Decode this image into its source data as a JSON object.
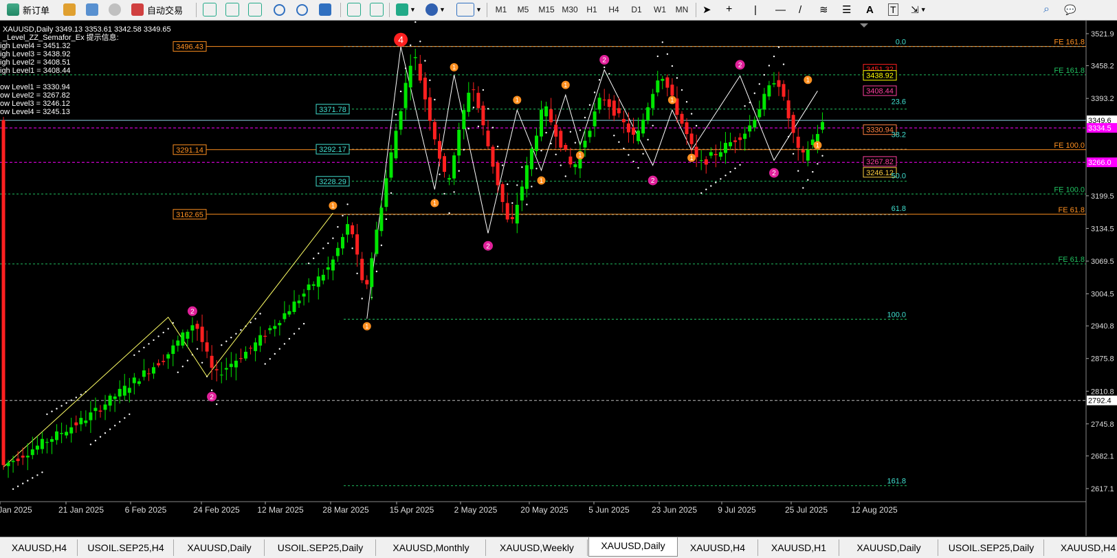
{
  "toolbar": {
    "new_order_label": "新订单",
    "auto_trade_label": "自动交易",
    "timeframes": [
      "M1",
      "M5",
      "M15",
      "M30",
      "H1",
      "H4",
      "D1",
      "W1",
      "MN"
    ]
  },
  "chart_info": {
    "symbol_line": "XAUUSD,Daily  3349.13 3353.61 3342.58 3349.65",
    "indicator_line": "_Level_ZZ_Semafor_Ex 提示信息:",
    "levels": [
      "igh Level4 = 3451.32",
      "igh Level3 = 3438.92",
      "igh Level2 = 3408.51",
      "igh Level1 = 3408.44",
      "ow Level1 = 3330.94",
      "ow Level2 = 3267.82",
      "ow Level3 = 3246.12",
      "ow Level4 = 3245.13"
    ]
  },
  "chart_data": {
    "type": "candlestick",
    "symbol": "XAUUSD",
    "timeframe": "Daily",
    "ohlc_last": {
      "open": 3349.13,
      "high": 3353.61,
      "low": 3342.58,
      "close": 3349.65
    },
    "y_ticks": [
      3521.9,
      3458.2,
      3393.2,
      3334.5,
      3266.0,
      3199.5,
      3134.5,
      3069.5,
      3004.5,
      2940.8,
      2875.8,
      2810.8,
      2792.4,
      2745.8,
      2682.1,
      2617.1
    ],
    "y_tick_labels": [
      "3521.9",
      "3458.2",
      "3393.2",
      "3349.6",
      "3334.5",
      "3266.0",
      "3199.5",
      "3134.5",
      "3069.5",
      "3004.5",
      "2940.8",
      "2875.8",
      "2810.8",
      "2792.4",
      "2745.8",
      "2682.1",
      "2617.1"
    ],
    "x_tick_labels": [
      "Jan 2025",
      "21 Jan 2025",
      "6 Feb 2025",
      "24 Feb 2025",
      "12 Mar 2025",
      "28 Mar 2025",
      "15 Apr 2025",
      "2 May 2025",
      "20 May 2025",
      "5 Jun 2025",
      "23 Jun 2025",
      "9 Jul 2025",
      "25 Jul 2025",
      "12 Aug 2025"
    ],
    "current_price": "3349.6",
    "price_marker_magenta": "3334.5",
    "price_marker_magenta2": "3266.0",
    "price_marker_white": "2792.4",
    "zone_labels_orange": [
      "3496.43",
      "3291.14",
      "3162.65"
    ],
    "zone_labels_cyan": [
      "3371.78",
      "3292.17",
      "3228.29"
    ],
    "right_level_labels": [
      {
        "text": "3451.32",
        "color": "#ff2020"
      },
      {
        "text": "3438.92",
        "color": "#ffff00"
      },
      {
        "text": "3408.44",
        "color": "#ff40a0"
      },
      {
        "text": "3330.94",
        "color": "#ff8040"
      },
      {
        "text": "3267.82",
        "color": "#ff40a0"
      },
      {
        "text": "3246.12",
        "color": "#ffd040"
      }
    ],
    "fib_levels": [
      "0.0",
      "23.6",
      "38.2",
      "50.0",
      "61.8",
      "100.0",
      "161.8"
    ],
    "fe_levels": [
      "FE 161.8",
      "FE 161.8",
      "FE 100.0",
      "FE 100.0",
      "FE 61.8",
      "FE 61.8"
    ],
    "semafor_top_label": "4",
    "colors": {
      "up": "#00e600",
      "down": "#ff2020",
      "zigzag_white": "#ffffff",
      "zigzag_yellow": "#ffff66",
      "orange": "#ff9020",
      "cyan": "#40e0d0",
      "magenta": "#ff00ff"
    }
  },
  "tabs": [
    "XAUUSD,H4",
    "USOIL.SEP25,H4",
    "XAUUSD,Daily",
    "USOIL.SEP25,Daily",
    "XAUUSD,Monthly",
    "XAUUSD,Weekly",
    "XAUUSD,Daily",
    "XAUUSD,H4",
    "XAUUSD,H1",
    "XAUUSD,Daily",
    "USOIL.SEP25,Daily",
    "XAUUSD,H4"
  ],
  "active_tab_index": 6
}
